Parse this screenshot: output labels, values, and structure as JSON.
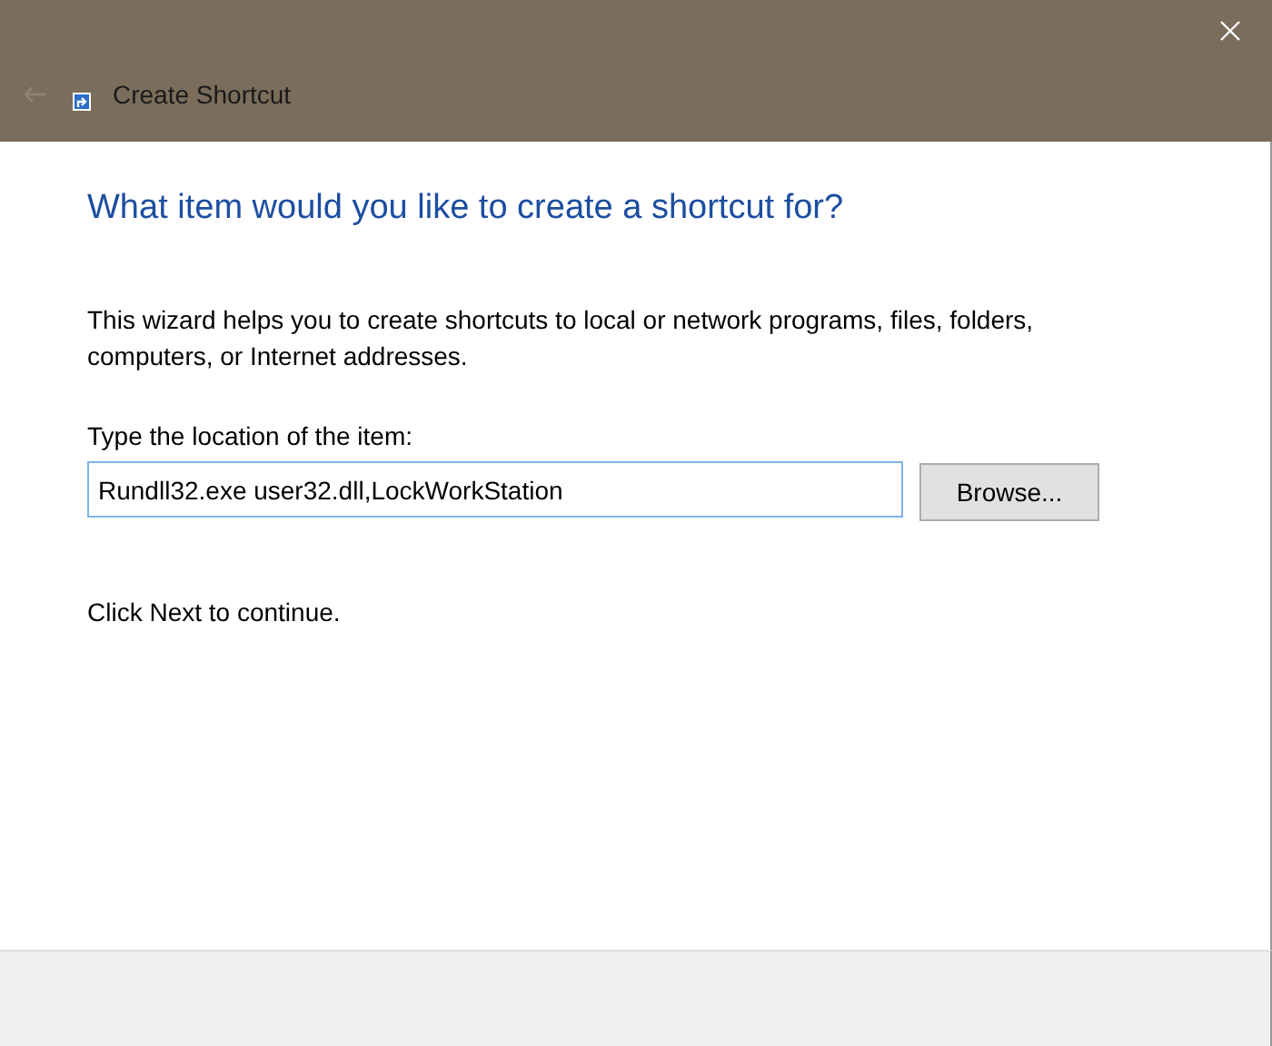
{
  "window": {
    "title": "Create Shortcut"
  },
  "heading": "What item would you like to create a shortcut for?",
  "intro": "This wizard helps you to create shortcuts to local or network programs, files, folders, computers, or Internet addresses.",
  "location": {
    "label": "Type the location of the item:",
    "value": "Rundll32.exe user32.dll,LockWorkStation"
  },
  "browse_button": "Browse...",
  "hint": "Click Next to continue."
}
